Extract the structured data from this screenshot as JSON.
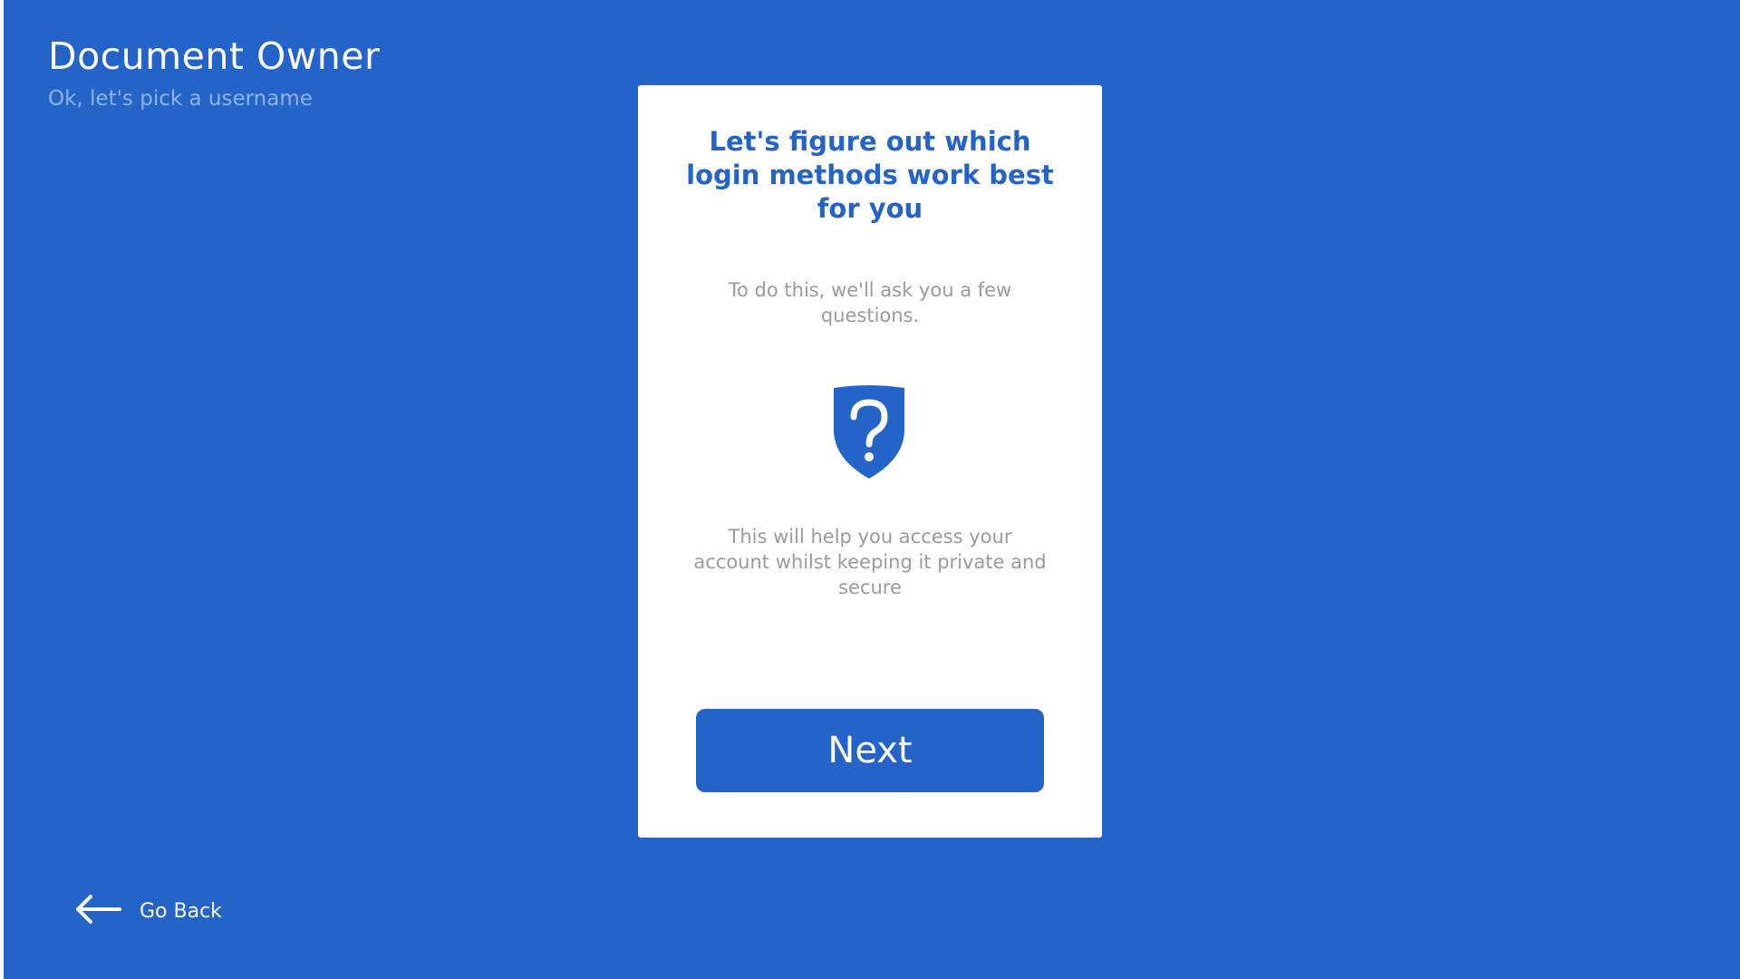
{
  "header": {
    "title": "Document Owner",
    "subtitle": "Ok, let's pick a username"
  },
  "card": {
    "heading": "Let's figure out which login methods work best for you",
    "intro": "To do this, we'll ask you a few questions.",
    "icon": "shield-question-icon",
    "outro": "This will help you access your account whilst keeping it private and secure",
    "next_label": "Next"
  },
  "footer": {
    "back_label": "Go Back",
    "back_icon": "arrow-left-icon"
  },
  "colors": {
    "background": "#2463c8",
    "card": "#ffffff",
    "accent": "#2463c8",
    "muted_text": "#9b9b9b",
    "subtitle_text": "#8fb3ee"
  }
}
